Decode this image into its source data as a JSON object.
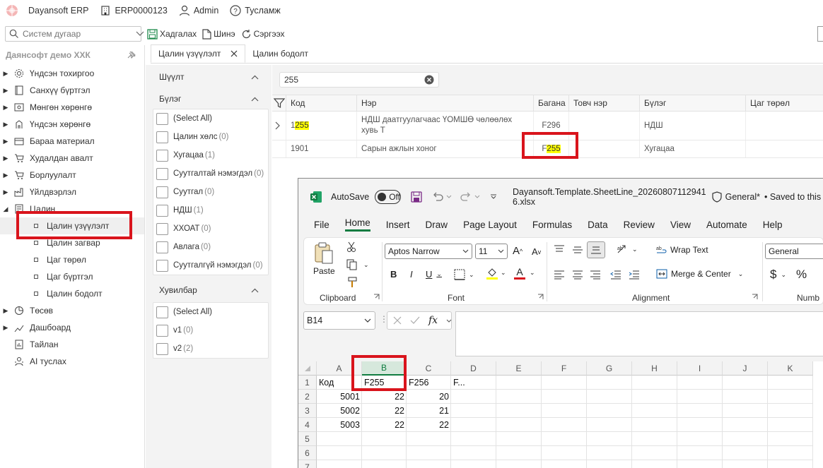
{
  "topbar": {
    "app_name": "Dayansoft ERP",
    "company_code": "ERP0000123",
    "user": "Admin",
    "help": "Тусламж"
  },
  "toolbar": {
    "search_placeholder": "Систем дугаар",
    "save": "Хадгалах",
    "new": "Шинэ",
    "refresh": "Сэргээх"
  },
  "leftnav": {
    "company": "Даянсофт демо ХХК",
    "items": [
      {
        "label": "Үндсэн тохиргоо",
        "icon": "gear-icon"
      },
      {
        "label": "Санхүү бүртгэл",
        "icon": "book-icon"
      },
      {
        "label": "Мөнгөн хөрөнгө",
        "icon": "cash-icon"
      },
      {
        "label": "Үндсэн хөрөнгө",
        "icon": "asset-icon"
      },
      {
        "label": "Бараа материал",
        "icon": "box-icon"
      },
      {
        "label": "Худалдан авалт",
        "icon": "cart-icon"
      },
      {
        "label": "Борлуулалт",
        "icon": "cart-icon"
      },
      {
        "label": "Үйлдвэрлэл",
        "icon": "factory-icon"
      },
      {
        "label": "Цалин",
        "icon": "payroll-icon"
      }
    ],
    "subitems": [
      "Цалин үзүүлэлт",
      "Цалин загвар",
      "Цаг төрөл",
      "Цаг бүртгэл",
      "Цалин бодолт"
    ],
    "bottom_items": [
      {
        "label": "Төсөв",
        "icon": "budget-icon"
      },
      {
        "label": "Дашбоард",
        "icon": "dashboard-icon"
      },
      {
        "label": "Тайлан",
        "icon": "report-icon"
      },
      {
        "label": "AI туслах",
        "icon": "ai-icon"
      }
    ]
  },
  "tabs": [
    {
      "label": "Цалин үзүүлэлт",
      "active": true
    },
    {
      "label": "Цалин бодолт",
      "active": false
    }
  ],
  "filter": {
    "title": "Шүүлт",
    "group1": {
      "title": "Бүлэг",
      "options": [
        {
          "label": "(Select All)",
          "count": ""
        },
        {
          "label": "Цалин хөлс",
          "count": "(0)"
        },
        {
          "label": "Хугацаа",
          "count": "(1)"
        },
        {
          "label": "Суутгалтай нэмэгдэл",
          "count": "(0)"
        },
        {
          "label": "Суутгал",
          "count": "(0)"
        },
        {
          "label": "НДШ",
          "count": "(1)"
        },
        {
          "label": "ХХОАТ",
          "count": "(0)"
        },
        {
          "label": "Авлага",
          "count": "(0)"
        },
        {
          "label": "Суутгалгүй нэмэгдэл",
          "count": "(0)"
        }
      ]
    },
    "group2": {
      "title": "Хувилбар",
      "options": [
        {
          "label": "(Select All)",
          "count": ""
        },
        {
          "label": "v1",
          "count": "(0)"
        },
        {
          "label": "v2",
          "count": "(2)"
        }
      ]
    }
  },
  "grid": {
    "search_value": "255",
    "columns": [
      "Код",
      "Нэр",
      "Багана",
      "Товч нэр",
      "Бүлэг",
      "Цаг төрөл"
    ],
    "rows": [
      {
        "code_pre": "1",
        "code_hl": "255",
        "name": "НДШ даатгуулагчаас ҮОМШӨ чөлөөлөх хувь Т",
        "column": "F296",
        "column_pre": "",
        "column_hl": "",
        "short": "",
        "group": "НДШ",
        "time": ""
      },
      {
        "code_pre": "1901",
        "code_hl": "",
        "name": "Сарын ажлын хоног",
        "column": "",
        "column_pre": "F",
        "column_hl": "255",
        "short": "",
        "group": "Хугацаа",
        "time": ""
      }
    ]
  },
  "excel": {
    "autosave": "AutoSave",
    "toggle": "Off",
    "filename": "Dayansoft.Template.SheetLine_20260807112941​6.xlsx",
    "sensitivity": "General*",
    "saved": "• Saved to this P",
    "menu": [
      "File",
      "Home",
      "Insert",
      "Draw",
      "Page Layout",
      "Formulas",
      "Data",
      "Review",
      "View",
      "Automate",
      "Help"
    ],
    "ribbon": {
      "paste": "Paste",
      "clipboard": "Clipboard",
      "font_name": "Aptos Narrow",
      "font_size": "11",
      "font_group": "Font",
      "wrap": "Wrap Text",
      "merge": "Merge & Center",
      "alignment": "Alignment",
      "number_format": "General",
      "number_group": "Numb",
      "bold": "B",
      "italic": "I",
      "underline": "U",
      "grow": "A",
      "shrink": "A",
      "font_color": "A",
      "currency": "$",
      "percent": "%"
    },
    "namebox": "B14",
    "fx": "fx",
    "col_headers": [
      "A",
      "B",
      "C",
      "D",
      "E",
      "F",
      "G",
      "H",
      "I",
      "J",
      "K"
    ],
    "row_headers": [
      "1",
      "2",
      "3",
      "4",
      "5",
      "6",
      "7"
    ],
    "cells": {
      "r1": [
        "Код",
        "F255",
        "F256",
        "F..."
      ],
      "r2": [
        "5001",
        "22",
        "20"
      ],
      "r3": [
        "5002",
        "22",
        "21"
      ],
      "r4": [
        "5003",
        "22",
        "22"
      ]
    }
  },
  "colors": {
    "highlight": "#ffff00",
    "red_box": "#d9141c",
    "excel_green": "#107c41"
  }
}
